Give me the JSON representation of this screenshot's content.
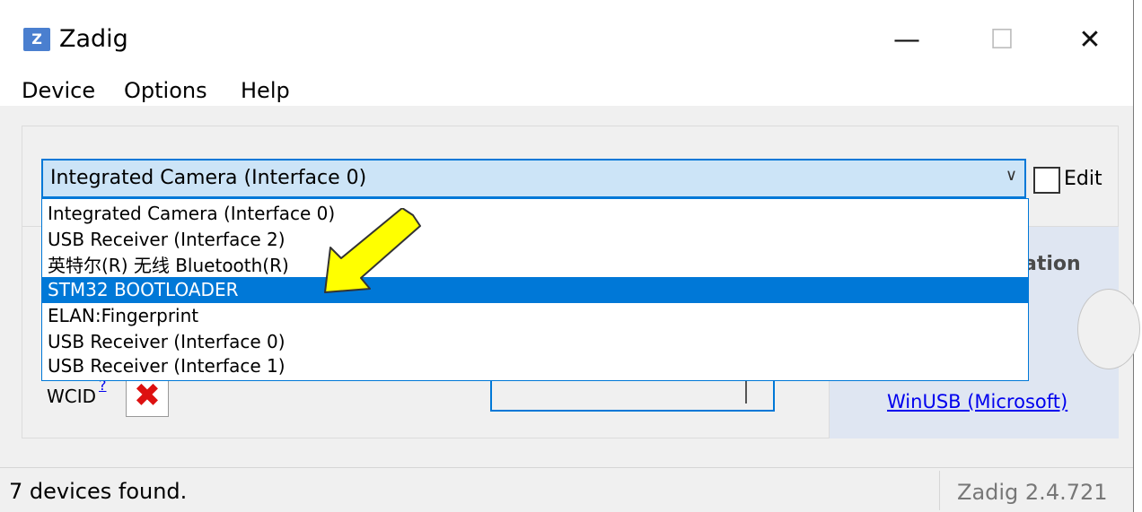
{
  "window": {
    "title": "Zadig",
    "icon_letter": "Z",
    "controls": {
      "minimize": "—",
      "maximize": "☐",
      "close": "✕"
    }
  },
  "menu": [
    "Device",
    "Options",
    "Help"
  ],
  "device_combo": {
    "selected": "Integrated Camera (Interface 0)",
    "arrow": "∨",
    "items": [
      "Integrated Camera (Interface 0)",
      "USB Receiver (Interface 2)",
      "英特尔(R) 无线 Bluetooth(R)",
      "STM32  BOOTLOADER",
      "ELAN:Fingerprint",
      "USB Receiver (Interface 0)",
      "USB Receiver (Interface 1)"
    ],
    "highlighted_index": 3
  },
  "edit_checkbox": {
    "label": "Edit",
    "checked": false
  },
  "wcid": {
    "label": "WCID",
    "help": "?",
    "status_mark": "✖"
  },
  "right_panel": {
    "title_fragment": "ation",
    "link_fragment": ")",
    "winusb_link": "WinUSB (Microsoft)"
  },
  "statusbar": {
    "text": "7 devices found.",
    "version": "Zadig 2.4.721"
  },
  "colors": {
    "accent": "#0078d7",
    "combo_bg": "#cce4f7",
    "arrow_fill": "#ffff00",
    "error_red": "#dd1111",
    "link": "#0000ee"
  }
}
